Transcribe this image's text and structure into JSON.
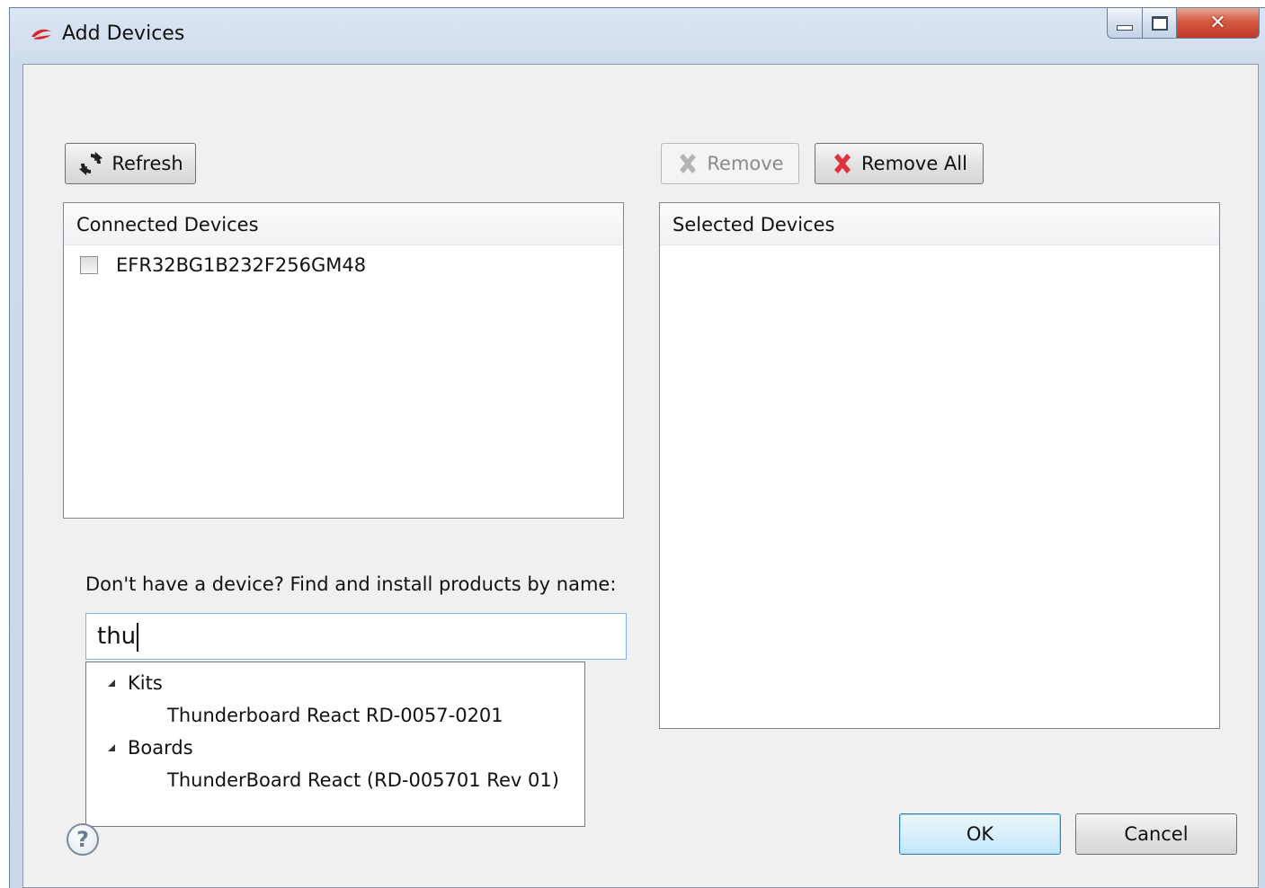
{
  "window": {
    "title": "Add Devices",
    "colors": {
      "close_button": "#c0392b",
      "focus_border": "#7eb4ea"
    }
  },
  "toolbar": {
    "refresh_label": "Refresh",
    "remove_label": "Remove",
    "remove_all_label": "Remove All"
  },
  "connected": {
    "header": "Connected Devices",
    "items": [
      {
        "label": "EFR32BG1B232F256GM48",
        "checked": false
      }
    ]
  },
  "selected": {
    "header": "Selected Devices",
    "items": []
  },
  "search": {
    "prompt": "Don't have a device? Find and install products by name:",
    "value": "thu"
  },
  "suggestions": {
    "groups": [
      {
        "label": "Kits",
        "items": [
          "Thunderboard React RD-0057-0201"
        ]
      },
      {
        "label": "Boards",
        "items": [
          "ThunderBoard React (RD-005701 Rev 01)"
        ]
      }
    ]
  },
  "footer": {
    "help_glyph": "?",
    "ok_label": "OK",
    "cancel_label": "Cancel"
  }
}
